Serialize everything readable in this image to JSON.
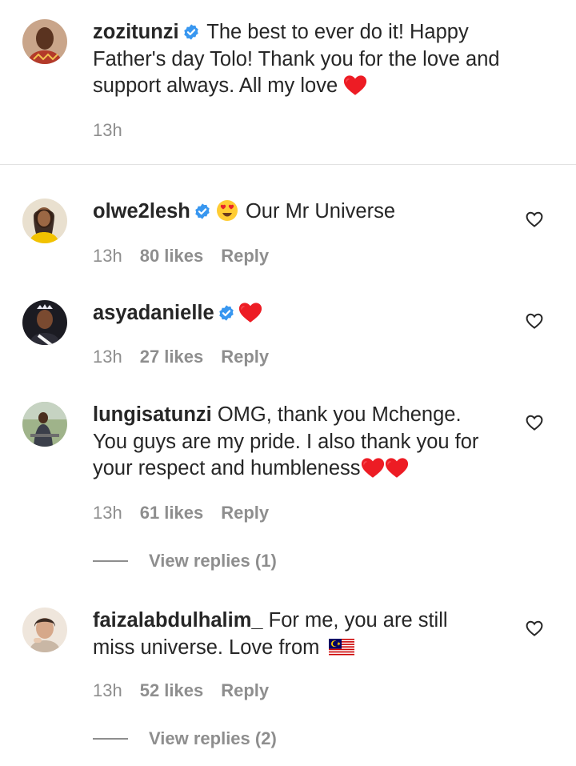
{
  "caption": {
    "username": "zozitunzi",
    "text_line1": " The best to ever do it! Happy",
    "text_line2": "Father's day Tolo! Thank you for the love and",
    "text_line3": "support always. All my love ",
    "time": "13h"
  },
  "comments": [
    {
      "username": "olwe2lesh",
      "text": " Our Mr Universe",
      "time": "13h",
      "likes": "80 likes",
      "reply_label": "Reply"
    },
    {
      "username": "asyadanielle",
      "text": "",
      "time": "13h",
      "likes": "27 likes",
      "reply_label": "Reply"
    },
    {
      "username": "lungisatunzi",
      "text_line1": " OMG, thank you Mchenge.",
      "text_line2": "You guys are my pride. I also thank you for",
      "text_line3": "your respect and humbleness",
      "time": "13h",
      "likes": "61 likes",
      "reply_label": "Reply",
      "view_replies": "View replies (1)"
    },
    {
      "username": "faizalabdulhalim_",
      "text_line1": " For me, you are still",
      "text_line2": "miss universe. Love from ",
      "time": "13h",
      "likes": "52 likes",
      "reply_label": "Reply",
      "view_replies": "View replies (2)"
    }
  ],
  "icons": {
    "verified": "verified-badge-icon",
    "heart_outline": "heart-outline-icon",
    "heart_emoji": "red-heart-emoji",
    "heart_eyes": "heart-eyes-emoji",
    "flag": "malaysia-flag-emoji"
  },
  "colors": {
    "text": "#262626",
    "meta": "#8e8e8e",
    "verified": "#3897f0",
    "heart": "#ed1c24"
  }
}
